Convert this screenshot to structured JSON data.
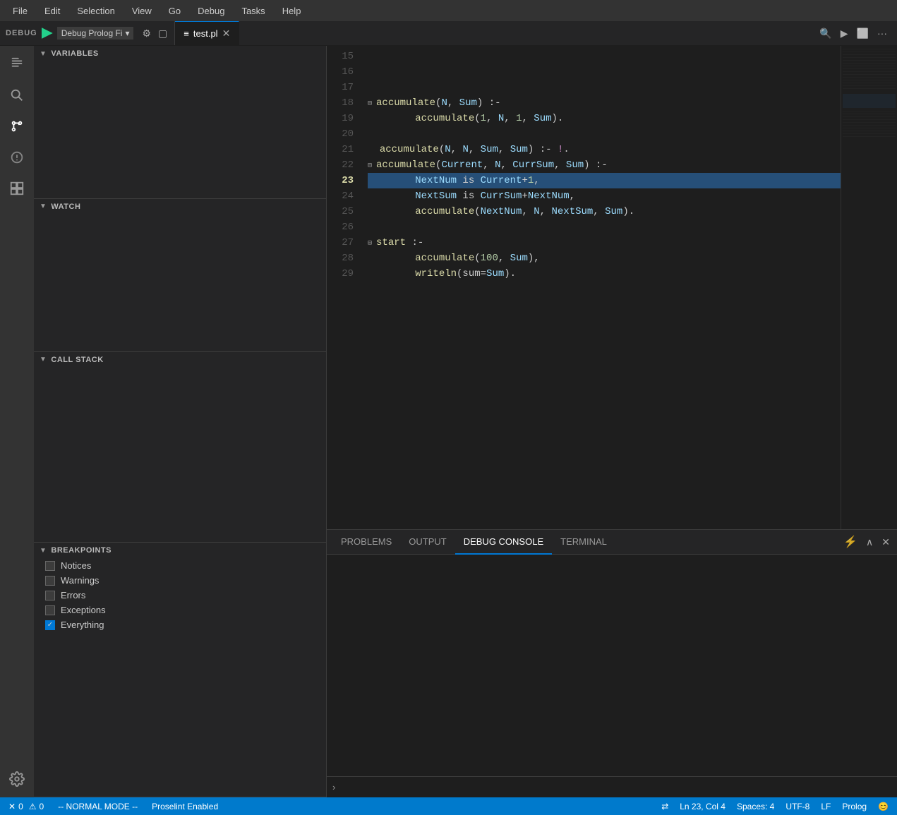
{
  "menubar": {
    "items": [
      "File",
      "Edit",
      "Selection",
      "View",
      "Go",
      "Debug",
      "Tasks",
      "Help"
    ]
  },
  "tabbar": {
    "debug_label": "DEBUG",
    "config_name": "Debug Prolog Fi",
    "tab": {
      "label": "test.pl",
      "icon": "≡"
    }
  },
  "activity_icons": [
    "📋",
    "🔍",
    "⎇",
    "🚫",
    "📑"
  ],
  "sidebar": {
    "variables_header": "VARIABLES",
    "watch_header": "WATCH",
    "callstack_header": "CALL STACK",
    "breakpoints_header": "BREAKPOINTS",
    "breakpoints": [
      {
        "label": "Notices",
        "checked": false
      },
      {
        "label": "Warnings",
        "checked": false
      },
      {
        "label": "Errors",
        "checked": false
      },
      {
        "label": "Exceptions",
        "checked": false
      },
      {
        "label": "Everything",
        "checked": true
      }
    ]
  },
  "editor": {
    "lines": [
      {
        "num": 15,
        "content": "",
        "tokens": []
      },
      {
        "num": 16,
        "content": "",
        "tokens": []
      },
      {
        "num": 17,
        "content": "",
        "tokens": []
      },
      {
        "num": 18,
        "content": "⊟ accumulate(N, Sum) :-",
        "fold": true
      },
      {
        "num": 19,
        "content": "    accumulate(1, N, 1, Sum).",
        "tokens": []
      },
      {
        "num": 20,
        "content": "",
        "tokens": []
      },
      {
        "num": 21,
        "content": "  accumulate(N, N, Sum, Sum) :- !.",
        "tokens": []
      },
      {
        "num": 22,
        "content": "⊟ accumulate(Current, N, CurrSum, Sum) :-",
        "fold": true
      },
      {
        "num": 23,
        "content": "    NextNum is Current+1,",
        "highlighted": true
      },
      {
        "num": 24,
        "content": "    NextSum is CurrSum+NextNum,",
        "tokens": []
      },
      {
        "num": 25,
        "content": "    accumulate(NextNum, N, NextSum, Sum).",
        "tokens": []
      },
      {
        "num": 26,
        "content": "",
        "tokens": []
      },
      {
        "num": 27,
        "content": "⊟ start :-",
        "fold": true
      },
      {
        "num": 28,
        "content": "    accumulate(100, Sum),",
        "tokens": []
      },
      {
        "num": 29,
        "content": "    writeln(sum=Sum).",
        "tokens": []
      }
    ]
  },
  "bottom_panel": {
    "tabs": [
      "PROBLEMS",
      "OUTPUT",
      "DEBUG CONSOLE",
      "TERMINAL"
    ],
    "active_tab": "DEBUG CONSOLE"
  },
  "status_bar": {
    "errors": "0",
    "warnings": "0",
    "mode": "-- NORMAL MODE --",
    "proselint": "Proselint Enabled",
    "line": "Ln 23, Col 4",
    "spaces": "Spaces: 4",
    "encoding": "UTF-8",
    "line_ending": "LF",
    "language": "Prolog",
    "face_icon": "😊"
  }
}
